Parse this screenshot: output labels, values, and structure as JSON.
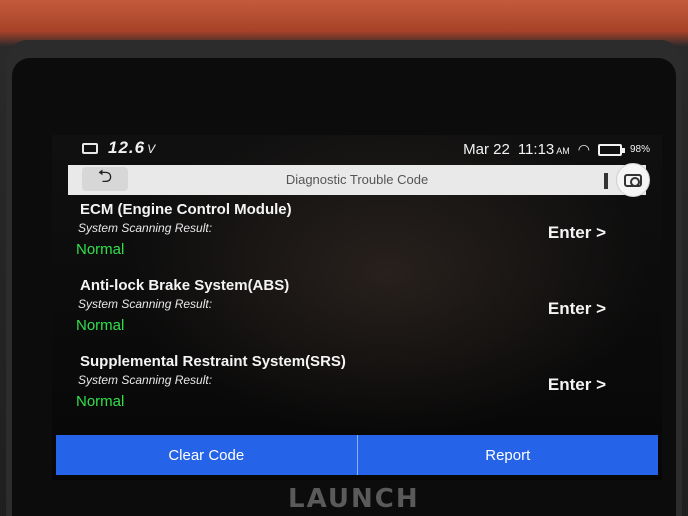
{
  "status_bar": {
    "voltage": "12.6",
    "voltage_unit": "V",
    "date": "Mar 22",
    "time": "11:13",
    "ampm": "AM",
    "battery_percent": "98%"
  },
  "title_bar": {
    "title": "Diagnostic Trouble Code",
    "back_icon": "return-arrow",
    "camera_icon": "camera"
  },
  "modules": [
    {
      "name": "ECM (Engine Control Module)",
      "scan_label": "System Scanning Result:",
      "result": "Normal",
      "enter_label": "Enter >"
    },
    {
      "name": "Anti-lock Brake System(ABS)",
      "scan_label": "System Scanning Result:",
      "result": "Normal",
      "enter_label": "Enter >"
    },
    {
      "name": "Supplemental Restraint System(SRS)",
      "scan_label": "System Scanning Result:",
      "result": "Normal",
      "enter_label": "Enter >"
    }
  ],
  "actions": {
    "clear_code": "Clear Code",
    "report": "Report"
  },
  "brand": "LAUNCH",
  "colors": {
    "accent": "#2563e8",
    "normal_status": "#2fe04a",
    "title_bar_bg": "#e9e9e9"
  }
}
